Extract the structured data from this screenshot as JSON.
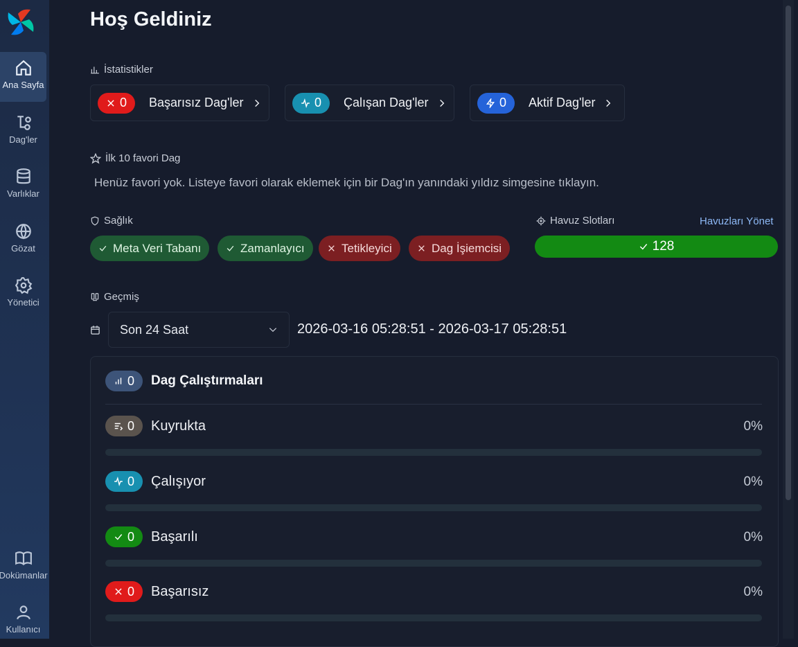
{
  "sidebar": {
    "items": [
      {
        "label": "Ana Sayfa",
        "icon": "home-icon"
      },
      {
        "label": "Dag'ler",
        "icon": "dags-icon"
      },
      {
        "label": "Varlıklar",
        "icon": "database-icon"
      },
      {
        "label": "Gözat",
        "icon": "globe-icon"
      },
      {
        "label": "Yönetici",
        "icon": "gear-icon"
      }
    ],
    "bottom": [
      {
        "label": "Dokümanlar",
        "icon": "book-icon"
      },
      {
        "label": "Kullanıcı",
        "icon": "user-icon"
      }
    ]
  },
  "page": {
    "title": "Hoş Geldiniz"
  },
  "stats": {
    "label": "İstatistikler",
    "cards": [
      {
        "count": "0",
        "label": "Başarısız Dag'ler",
        "color": "#e01b1b",
        "icon": "x-icon"
      },
      {
        "count": "0",
        "label": "Çalışan Dag'ler",
        "color": "#1890b0",
        "icon": "activity-icon"
      },
      {
        "count": "0",
        "label": "Aktif Dag'ler",
        "color": "#2563d9",
        "icon": "bolt-icon"
      }
    ]
  },
  "favorites": {
    "label": "İlk 10 favori Dag",
    "empty_text": "Henüz favori yok. Listeye favori olarak eklemek için bir Dag'ın yanındaki yıldız simgesine tıklayın."
  },
  "health": {
    "label": "Sağlık",
    "items": [
      {
        "label": "Meta Veri Tabanı",
        "status": "ok"
      },
      {
        "label": "Zamanlayıcı",
        "status": "ok"
      },
      {
        "label": "Tetikleyici",
        "status": "error"
      },
      {
        "label": "Dag İşiemcisi",
        "status": "error"
      }
    ]
  },
  "pool": {
    "label": "Havuz Slotları",
    "manage_link": "Havuzları Yönet",
    "value": "128",
    "color": "#138a13"
  },
  "history": {
    "label": "Geçmiş",
    "range_select": "Son 24 Saat",
    "date_range": "2026-03-16 05:28:51 - 2026-03-17 05:28:51",
    "runs_title": "Dag Çalıştırmaları",
    "runs_count": "0",
    "rows": [
      {
        "label": "Kuyrukta",
        "count": "0",
        "percent": "0%",
        "fraction": 0,
        "color": "#5a534d"
      },
      {
        "label": "Çalışıyor",
        "count": "0",
        "percent": "0%",
        "fraction": 0,
        "color": "#1890b0"
      },
      {
        "label": "Başarılı",
        "count": "0",
        "percent": "0%",
        "fraction": 0,
        "color": "#138a13"
      },
      {
        "label": "Başarısız",
        "count": "0",
        "percent": "0%",
        "fraction": 0,
        "color": "#e01b1b"
      }
    ]
  }
}
